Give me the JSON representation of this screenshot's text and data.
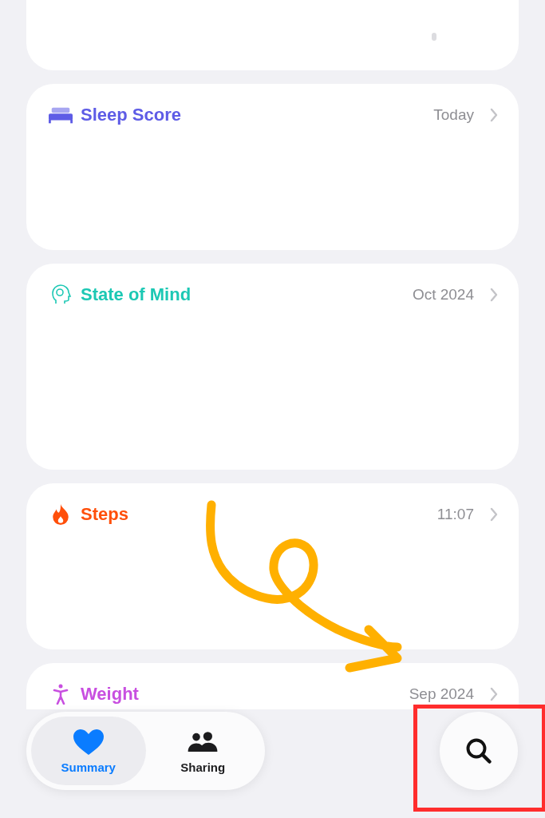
{
  "cards": [
    {
      "kind": "partial"
    },
    {
      "kind": "metric",
      "title": "Sleep Score",
      "color": "#5e5ce6",
      "date": "Today"
    },
    {
      "kind": "metric",
      "title": "State of Mind",
      "color": "#1cc8b4",
      "date": "Oct 2024"
    },
    {
      "kind": "metric",
      "title": "Steps",
      "color": "#ff4f0a",
      "date": "11:07"
    },
    {
      "kind": "metric",
      "title": "Weight",
      "color": "#c84fe0",
      "date": "Sep 2024"
    }
  ],
  "tabs": [
    {
      "label": "Summary",
      "selected": true
    },
    {
      "label": "Sharing",
      "selected": false
    }
  ]
}
